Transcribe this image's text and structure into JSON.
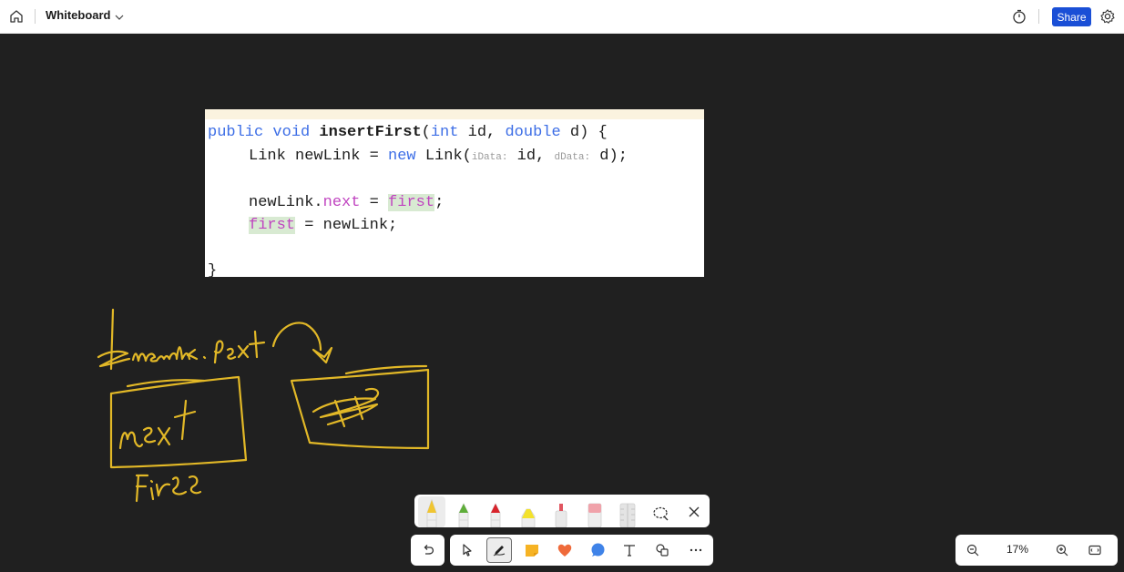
{
  "header": {
    "app_title": "Whiteboard",
    "share_label": "Share"
  },
  "code": {
    "lines": [
      "public void insertFirst(int id, double d) {",
      "Link newLink = new Link(iData: id, dData: d);",
      "newLink.next = first;",
      "first = newLink;",
      "}"
    ],
    "hint_iData": "iData:",
    "hint_dData": "dData:"
  },
  "ink": {
    "color": "#e2b827",
    "labels": [
      "newlink.next",
      "next",
      "first"
    ]
  },
  "pen_tray": {
    "pens": [
      "pencil-yellow",
      "pen-green",
      "pen-red",
      "highlighter-yellow",
      "eraser-red-tip",
      "eraser-pink",
      "ruler"
    ],
    "active": "pencil-yellow"
  },
  "toolbar": {
    "tools": [
      "undo",
      "select",
      "pen",
      "sticky-note",
      "reaction-heart",
      "comment",
      "text",
      "shapes",
      "more"
    ],
    "active": "pen"
  },
  "zoom": {
    "level": "17%"
  },
  "colors": {
    "canvas": "#202020",
    "share": "#1a4fd6",
    "ink": "#e2b827"
  }
}
